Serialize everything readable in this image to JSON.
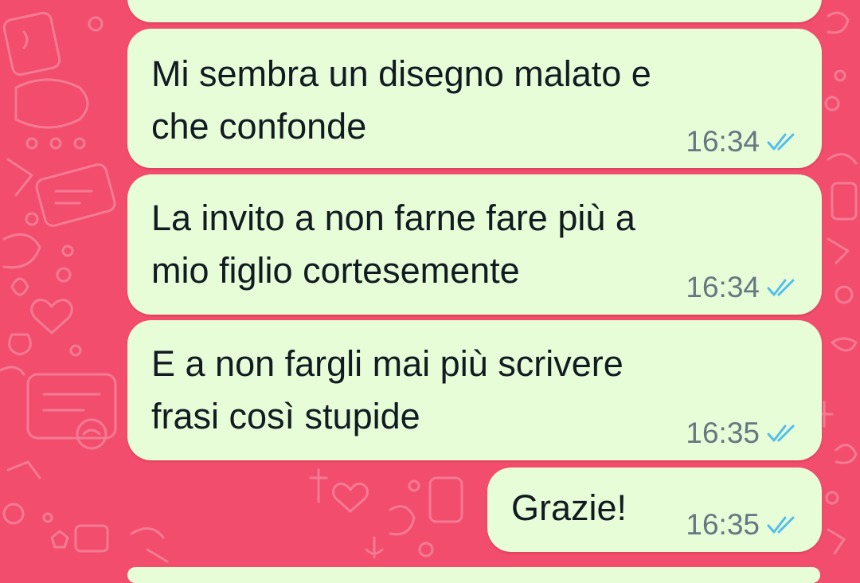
{
  "colors": {
    "wallpaper": "#f24d6c",
    "bubble": "#e7fdd8",
    "message_text": "#111b21",
    "timestamp": "#667781",
    "read_ticks": "#53bdeb"
  },
  "messages": [
    {
      "lines": [
        "Mi sembra un disegno malato e",
        "che confonde"
      ],
      "time": "16:34",
      "status_icon": "double-check-read-icon"
    },
    {
      "lines": [
        "La invito a non farne fare più a",
        "mio figlio cortesemente"
      ],
      "time": "16:34",
      "status_icon": "double-check-read-icon"
    },
    {
      "lines": [
        "E a non fargli mai più scrivere",
        "frasi così stupide"
      ],
      "time": "16:35",
      "status_icon": "double-check-read-icon"
    },
    {
      "lines": [
        "Grazie!"
      ],
      "time": "16:35",
      "status_icon": "double-check-read-icon"
    }
  ]
}
